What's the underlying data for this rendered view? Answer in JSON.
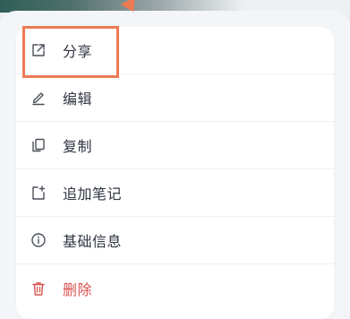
{
  "menu": {
    "items": [
      {
        "label": "分享",
        "icon": "share-icon"
      },
      {
        "label": "编辑",
        "icon": "edit-icon"
      },
      {
        "label": "复制",
        "icon": "copy-icon"
      },
      {
        "label": "追加笔记",
        "icon": "add-note-icon"
      },
      {
        "label": "基础信息",
        "icon": "info-icon"
      },
      {
        "label": "删除",
        "icon": "trash-icon"
      }
    ]
  },
  "colors": {
    "text": "#2f3440",
    "danger": "#d9534f",
    "highlight": "#ee7a52",
    "panel": "#ffffff",
    "background": "#f3f5f8"
  }
}
